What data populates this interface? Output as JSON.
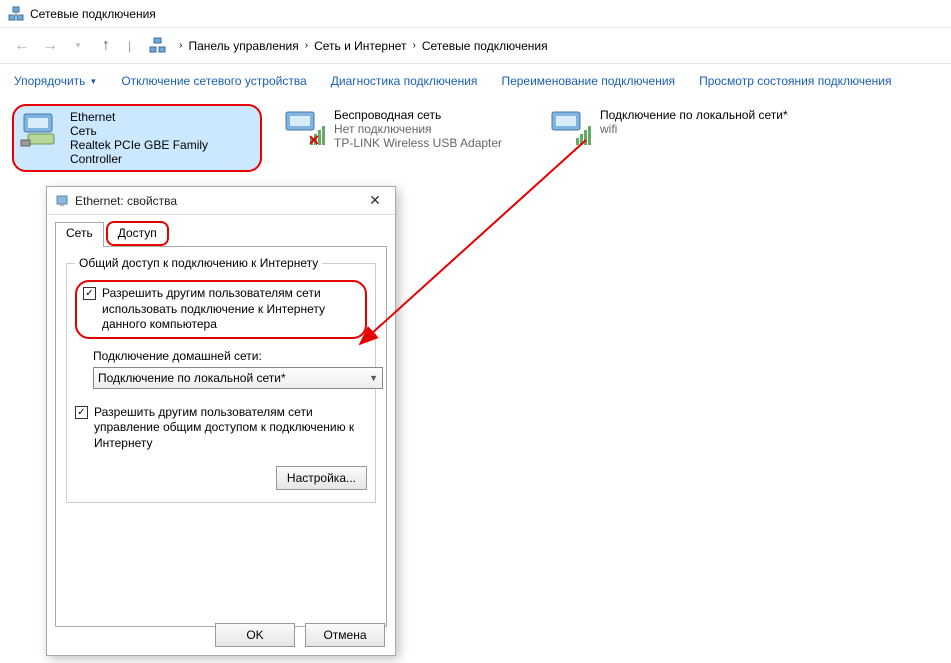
{
  "window": {
    "title": "Сетевые подключения"
  },
  "breadcrumb": {
    "items": [
      "Панель управления",
      "Сеть и Интернет",
      "Сетевые подключения"
    ]
  },
  "toolbar": {
    "organize": "Упорядочить",
    "disable": "Отключение сетевого устройства",
    "diagnose": "Диагностика подключения",
    "rename": "Переименование подключения",
    "status": "Просмотр состояния подключения"
  },
  "connections": [
    {
      "name": "Ethernet",
      "status": "Сеть",
      "device": "Realtek PCIe GBE Family Controller"
    },
    {
      "name": "Беспроводная сеть",
      "status": "Нет подключения",
      "device": "TP-LINK Wireless USB Adapter"
    },
    {
      "name": "Подключение по локальной сети*",
      "status": "wifi",
      "device": ""
    }
  ],
  "dialog": {
    "title": "Ethernet: свойства",
    "tabs": {
      "network": "Сеть",
      "sharing": "Доступ"
    },
    "group_legend": "Общий доступ к подключению к Интернету",
    "allow_share": "Разрешить другим пользователям сети использовать подключение к Интернету данного компьютера",
    "home_label": "Подключение домашней сети:",
    "home_value": "Подключение по локальной сети*",
    "allow_control": "Разрешить другим пользователям сети управление общим доступом к подключению к Интернету",
    "settings_btn": "Настройка...",
    "ok": "OK",
    "cancel": "Отмена"
  }
}
